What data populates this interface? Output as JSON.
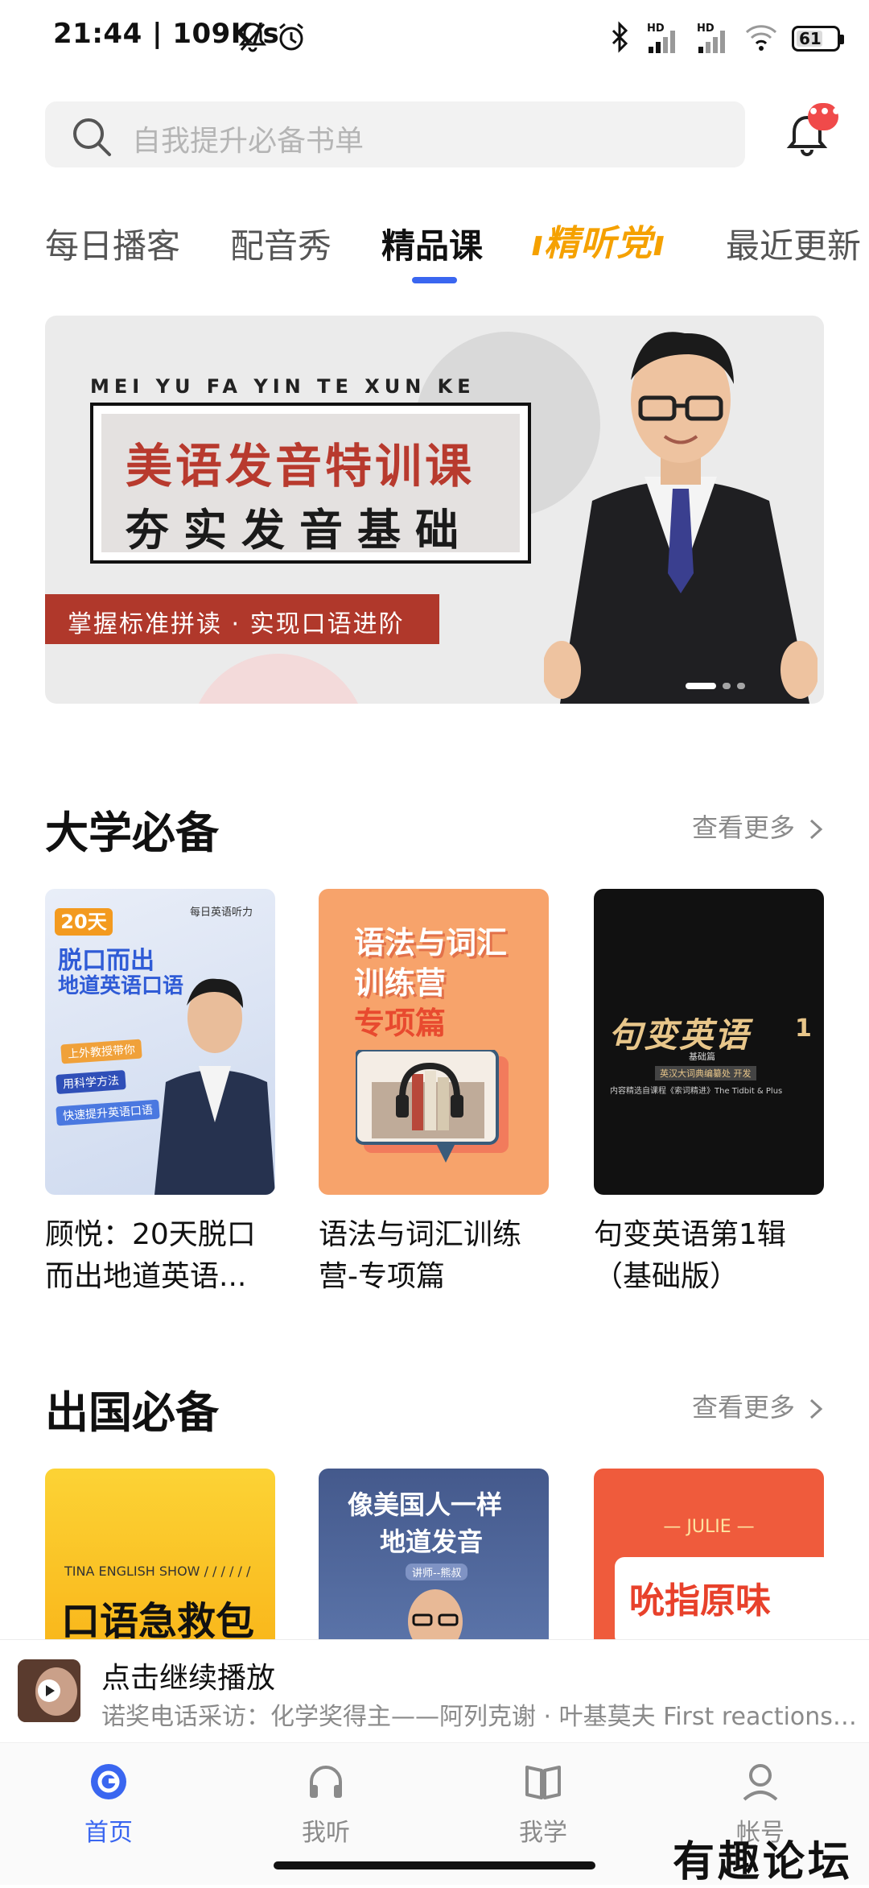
{
  "status_bar": {
    "time_speed": "21:44 | 109K/s",
    "hd1": "HD",
    "hd2": "HD",
    "battery": "61"
  },
  "search": {
    "placeholder": "自我提升必备书单"
  },
  "notification_badge": "•••",
  "tabs": [
    "每日播客",
    "配音秀",
    "精品课",
    "精听党",
    "最近更新"
  ],
  "active_tab": "精品课",
  "banner": {
    "pinyin": "MEI YU FA YIN TE XUN KE",
    "title1": "美语发音特训课",
    "title2": "夯实发音基础",
    "subtitle": "掌握标准拼读 · 实现口语进阶"
  },
  "sections": [
    {
      "title": "大学必备",
      "more": "查看更多",
      "items": [
        {
          "caption_line1": "顾悦：20天脱口",
          "caption_line2": "而出地道英语...",
          "cover": {
            "tag": "20天",
            "brand": "每日英语听力",
            "headline1": "脱口而出",
            "headline2": "地道英语口语",
            "chips": [
              "上外教授带你",
              "用科学方法",
              "快速提升英语口语"
            ]
          }
        },
        {
          "caption_line1": "语法与词汇训练",
          "caption_line2": "营-专项篇",
          "cover": {
            "line1": "语法与词汇",
            "line2": "训练营",
            "line3": "专项篇"
          }
        },
        {
          "caption_line1": "句变英语第1辑",
          "caption_line2": "（基础版）",
          "cover": {
            "title": "句变英语",
            "num": "1",
            "sub": "基础篇",
            "line1": "英汉大词典编纂处 开发",
            "line2": "内容精选自课程《索词精进》The Tidbit & Plus"
          }
        }
      ]
    },
    {
      "title": "出国必备",
      "more": "查看更多",
      "items": [
        {
          "cover": {
            "top": "TINA ENGLISH SHOW / / / / / /",
            "title": "口语急救包"
          }
        },
        {
          "cover": {
            "line1": "像美国人一样",
            "line2": "地道发音",
            "teacher": "讲师--熊叔"
          }
        },
        {
          "cover": {
            "top": "JULIE",
            "title": "吮指原味"
          }
        }
      ]
    }
  ],
  "player": {
    "title": "点击继续播放",
    "subtitle": "诺奖电话采访：化学奖得主——阿列克谢 · 叶基莫夫 First reactions |..."
  },
  "nav": [
    {
      "label": "首页",
      "icon": "home-icon",
      "active": true
    },
    {
      "label": "我听",
      "icon": "headphones-icon",
      "active": false
    },
    {
      "label": "我学",
      "icon": "book-icon",
      "active": false
    },
    {
      "label": "帐号",
      "icon": "account-icon",
      "active": false
    }
  ],
  "watermark": "有趣论坛",
  "colors": {
    "accent": "#3a66f0",
    "badge": "#f04a4a",
    "banner_red": "#b0382b",
    "tab_special": "#f5a100"
  }
}
